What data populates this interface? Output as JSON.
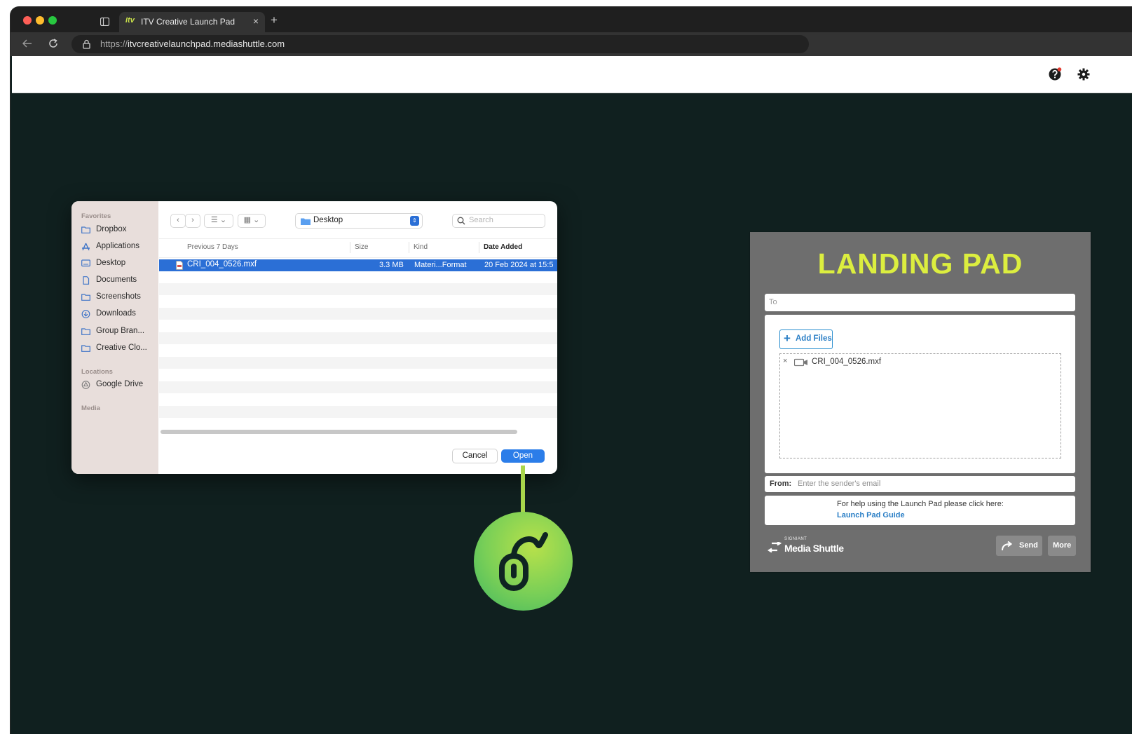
{
  "browser": {
    "tab_title": "ITV Creative Launch Pad",
    "tab_close": "×",
    "new_tab": "+",
    "url_scheme": "https://",
    "url_host": "itvcreativelaunchpad.mediashuttle.com",
    "logo_text": "itv"
  },
  "dialog": {
    "sidebar": {
      "favorites_heading": "Favorites",
      "favorites": [
        {
          "label": "Dropbox",
          "icon": "folder-icon"
        },
        {
          "label": "Applications",
          "icon": "applications-icon"
        },
        {
          "label": "Desktop",
          "icon": "desktop-icon"
        },
        {
          "label": "Documents",
          "icon": "document-icon"
        },
        {
          "label": "Screenshots",
          "icon": "folder-icon"
        },
        {
          "label": "Downloads",
          "icon": "download-icon"
        },
        {
          "label": "Group Bran...",
          "icon": "folder-icon"
        },
        {
          "label": "Creative Clo...",
          "icon": "folder-icon"
        }
      ],
      "locations_heading": "Locations",
      "locations": [
        {
          "label": "Google Drive",
          "icon": "google-drive-icon"
        }
      ],
      "media_heading": "Media"
    },
    "location": "Desktop",
    "search_placeholder": "Search",
    "columns": {
      "name": "Previous 7 Days",
      "size": "Size",
      "kind": "Kind",
      "date": "Date Added"
    },
    "files": [
      {
        "name": "CRI_004_0526.mxf",
        "size": "3.3 MB",
        "kind": "Materi...Format",
        "date": "20 Feb 2024 at 15:5",
        "selected": true
      }
    ],
    "cancel_label": "Cancel",
    "open_label": "Open"
  },
  "landing_pad": {
    "title": "LANDING PAD",
    "to_placeholder": "To",
    "add_files_label": "Add Files",
    "files": [
      {
        "name": "CRI_004_0526.mxf",
        "remove": "×"
      }
    ],
    "from_label": "From:",
    "from_placeholder": "Enter the sender's email",
    "help_text": "For help using the Launch Pad please click here:",
    "help_link": "Launch Pad Guide",
    "brand_small": "SIGNIANT",
    "brand_name": "Media Shuttle",
    "send_label": "Send",
    "more_label": "More"
  },
  "colors": {
    "title": "#dcee3f",
    "accent_blue": "#2b6fd6",
    "page_bg": "#10201f",
    "badge_green": "#79cf57"
  }
}
